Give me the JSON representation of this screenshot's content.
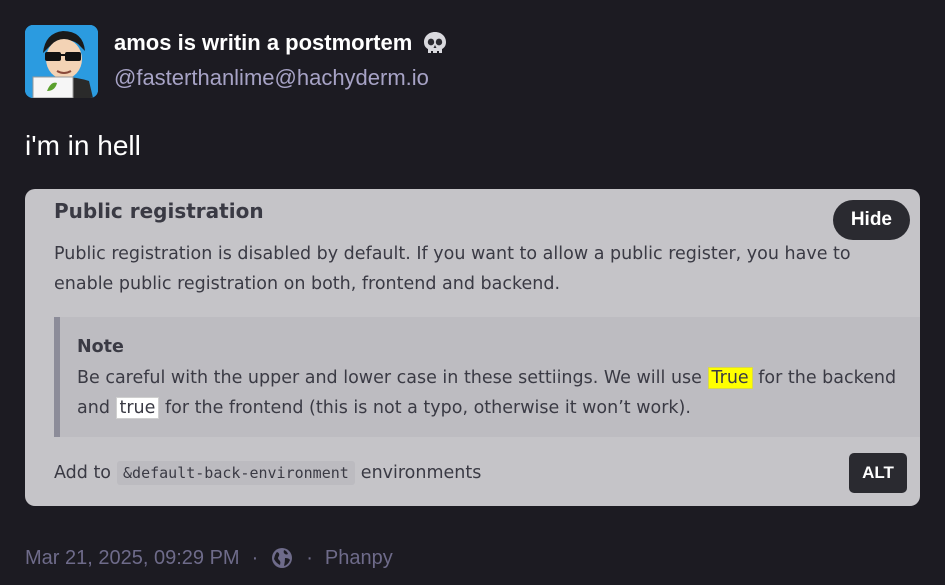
{
  "author": {
    "display_name": "amos is writin a postmortem",
    "emoji": "skull-emoji",
    "handle": "@fasterthanlime@hachyderm.io"
  },
  "status": {
    "text": "i'm in hell"
  },
  "media": {
    "hide_label": "Hide",
    "alt_label": "ALT",
    "doc": {
      "title": "Public registration",
      "paragraph": "Public registration is disabled by default. If you want to allow a public register, you have to enable public registration on both, frontend and backend.",
      "note_title": "Note",
      "note_before": "Be careful with the upper and lower case in these settiings. We will use ",
      "note_code_backend": "True",
      "note_middle": " for the backend and ",
      "note_code_frontend": "true",
      "note_after": " for the frontend (this is not a typo, otherwise it won’t work).",
      "add_prefix": "Add to",
      "add_code": "&default-back-environment",
      "add_suffix": "environments"
    }
  },
  "meta": {
    "timestamp": "Mar 21, 2025, 09:29 PM",
    "separator": "·",
    "visibility_icon": "globe-icon",
    "client": "Phanpy"
  },
  "colors": {
    "background": "#1c1b22",
    "handle": "#a7a3c6",
    "meta": "#6e6b8a",
    "media_bg": "#c5c4c8",
    "highlight_yellow": "#ffff00"
  }
}
